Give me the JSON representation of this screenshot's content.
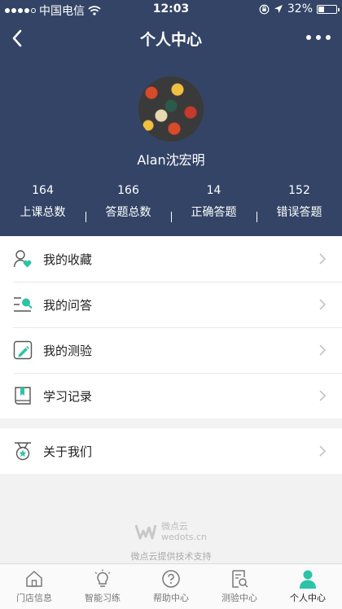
{
  "status_bar": {
    "carrier": "中国电信",
    "time": "12:03",
    "battery_percent": "32%",
    "battery_level": 0.32
  },
  "nav": {
    "title": "个人中心",
    "back_icon": "back-chevron-icon",
    "more_icon": "more-dots-icon"
  },
  "profile": {
    "username": "Alan沈宏明"
  },
  "stats": [
    {
      "value": "164",
      "label": "上课总数"
    },
    {
      "value": "166",
      "label": "答题总数"
    },
    {
      "value": "14",
      "label": "正确答题"
    },
    {
      "value": "152",
      "label": "错误答题"
    }
  ],
  "menu": [
    {
      "label": "我的收藏",
      "icon": "favorite-user-icon"
    },
    {
      "label": "我的问答",
      "icon": "qa-list-icon"
    },
    {
      "label": "我的测验",
      "icon": "quiz-pen-icon"
    },
    {
      "label": "学习记录",
      "icon": "study-book-icon"
    }
  ],
  "menu2": [
    {
      "label": "关于我们",
      "icon": "about-badge-icon"
    }
  ],
  "brand": {
    "name": "微点云",
    "domain": "wedots.cn",
    "caption": "微点云提供技术支持"
  },
  "tabbar": [
    {
      "label": "门店信息",
      "icon": "store-home-icon",
      "active": false
    },
    {
      "label": "智能习练",
      "icon": "bulb-icon",
      "active": false
    },
    {
      "label": "帮助中心",
      "icon": "help-icon",
      "active": false
    },
    {
      "label": "测验中心",
      "icon": "quiz-search-icon",
      "active": false
    },
    {
      "label": "个人中心",
      "icon": "person-icon",
      "active": true
    }
  ],
  "colors": {
    "header_bg": "#334466",
    "accent": "#2bc4a6",
    "page_bg": "#f2f2f2"
  }
}
